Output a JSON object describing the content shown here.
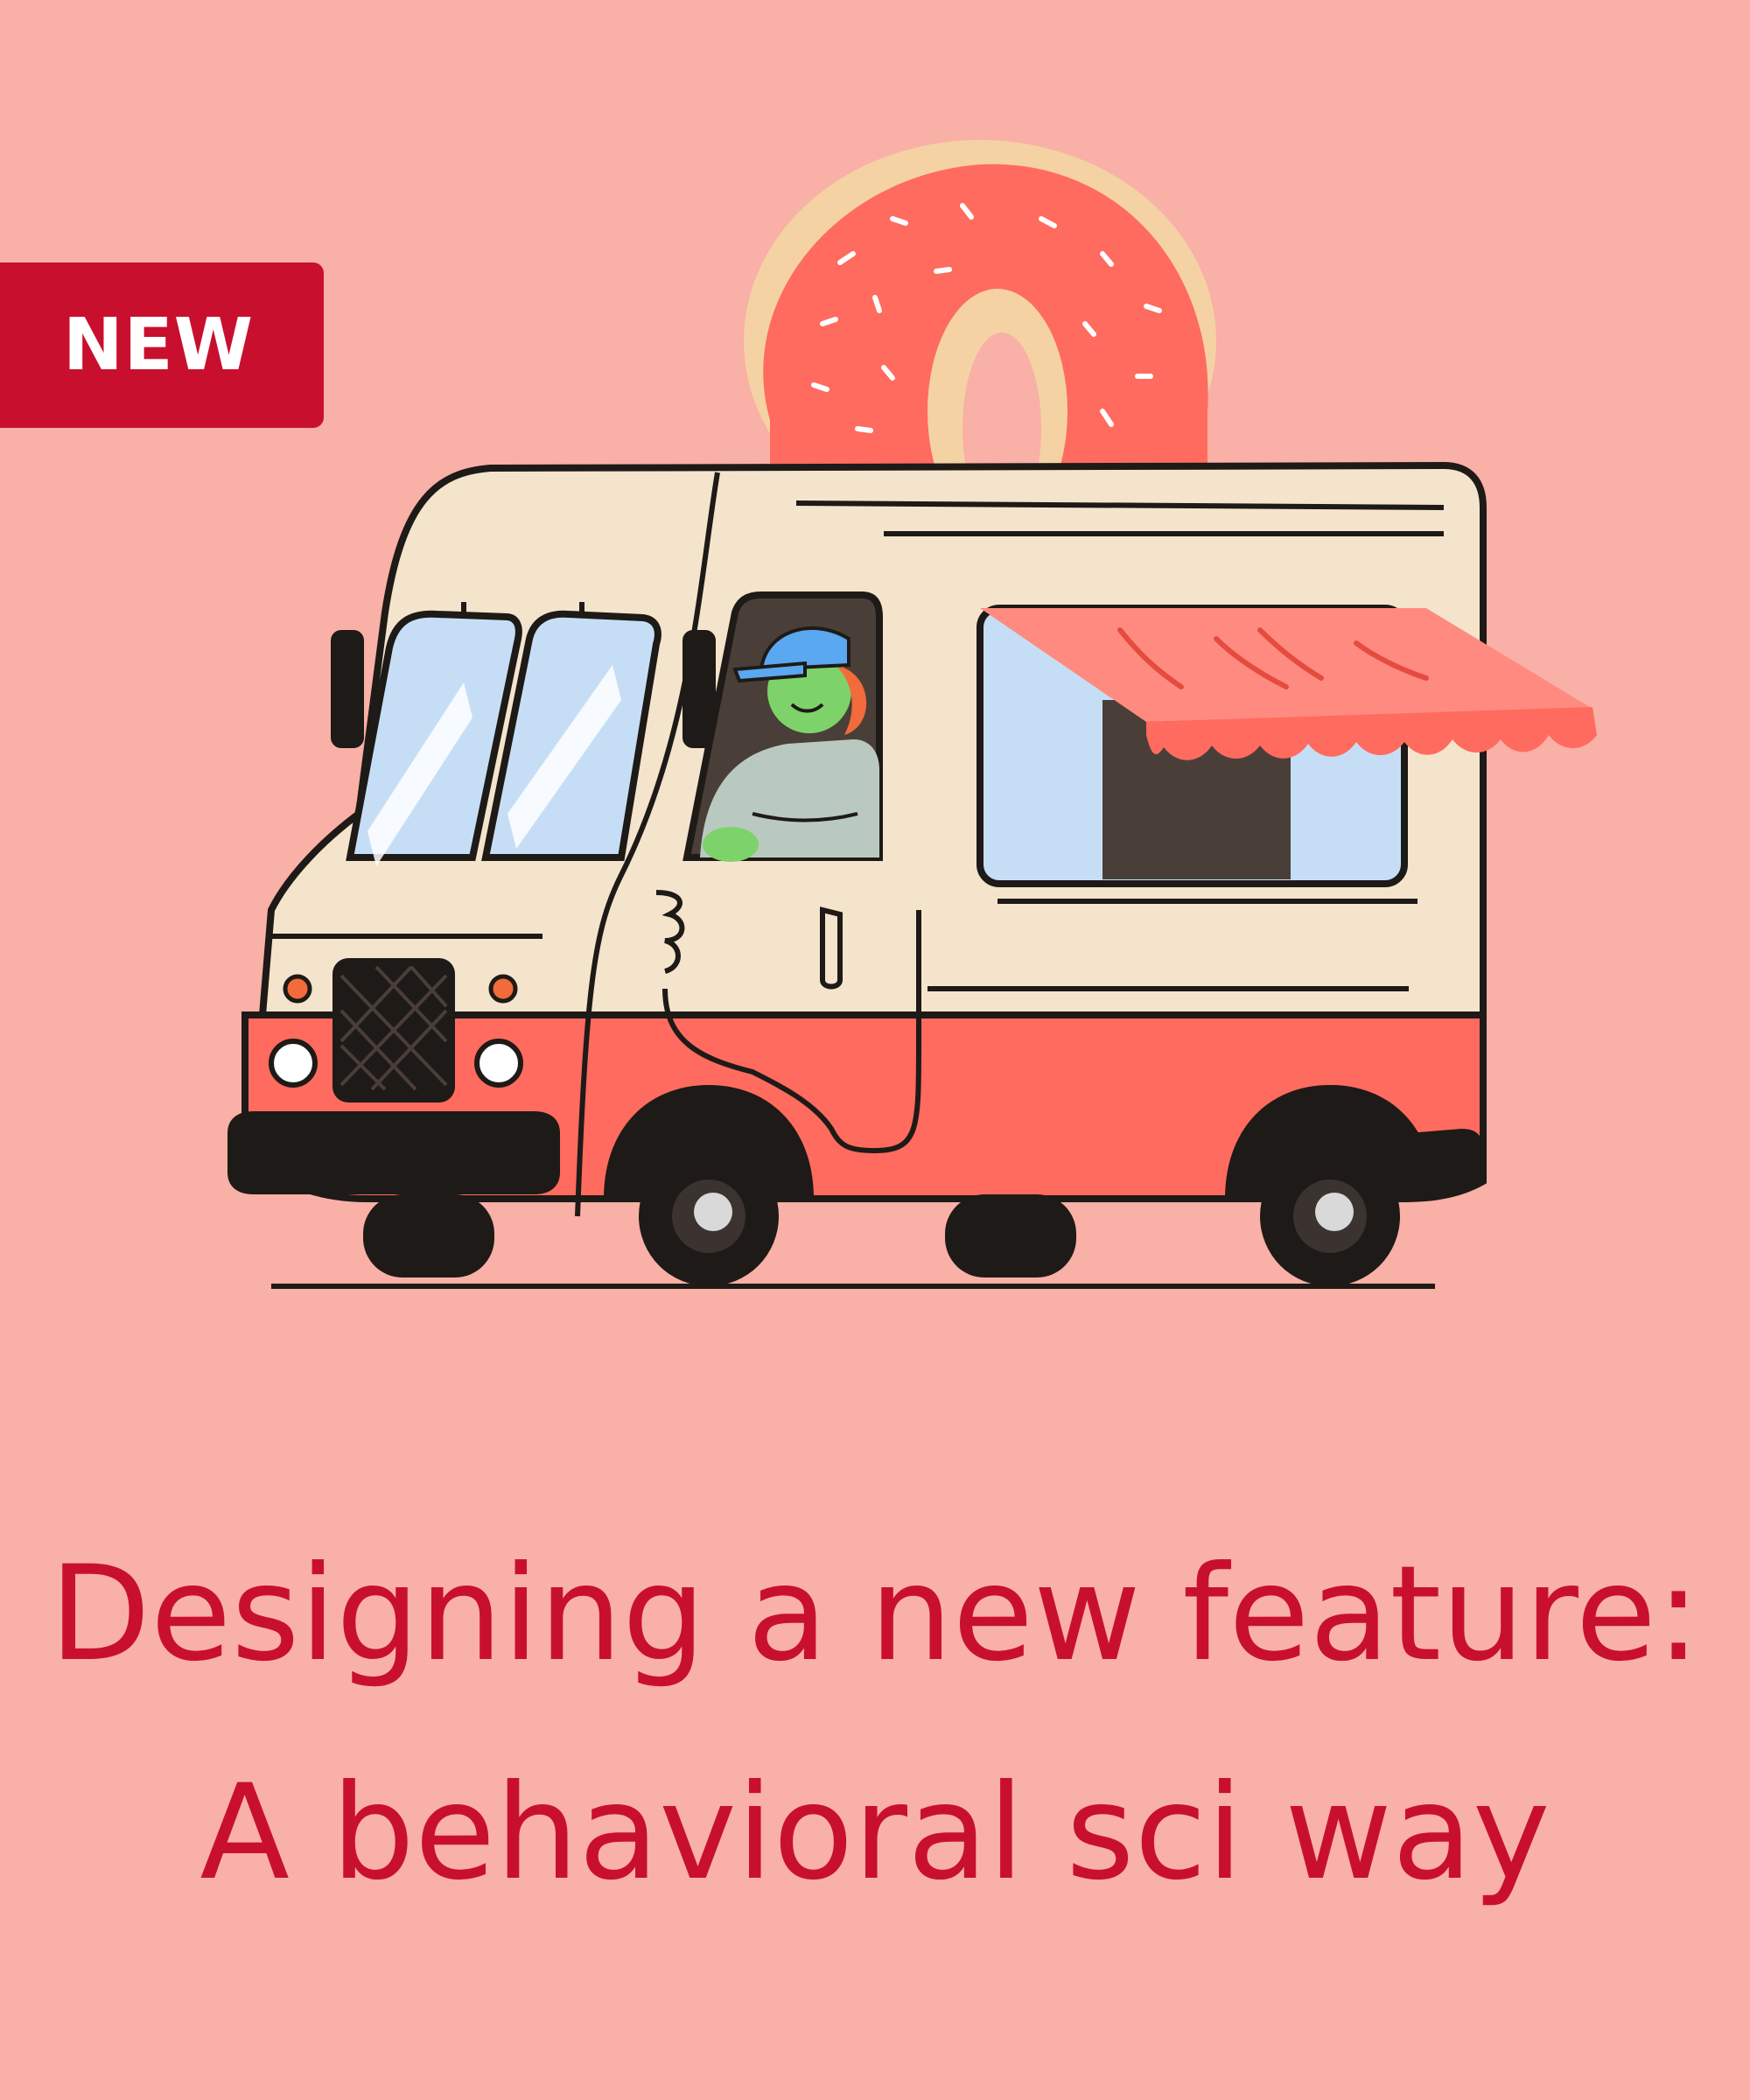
{
  "badge": {
    "label": "NEW"
  },
  "headline": {
    "line1": "Designing a new feature:",
    "line2": "A behavioral sci way"
  },
  "colors": {
    "background": "#F9B0A6",
    "accent": "#C8102E",
    "truck_cream": "#F4E4CC",
    "truck_red": "#FF6B5E",
    "outline": "#1E1A17"
  },
  "illustration": {
    "subject": "donut-food-truck"
  }
}
